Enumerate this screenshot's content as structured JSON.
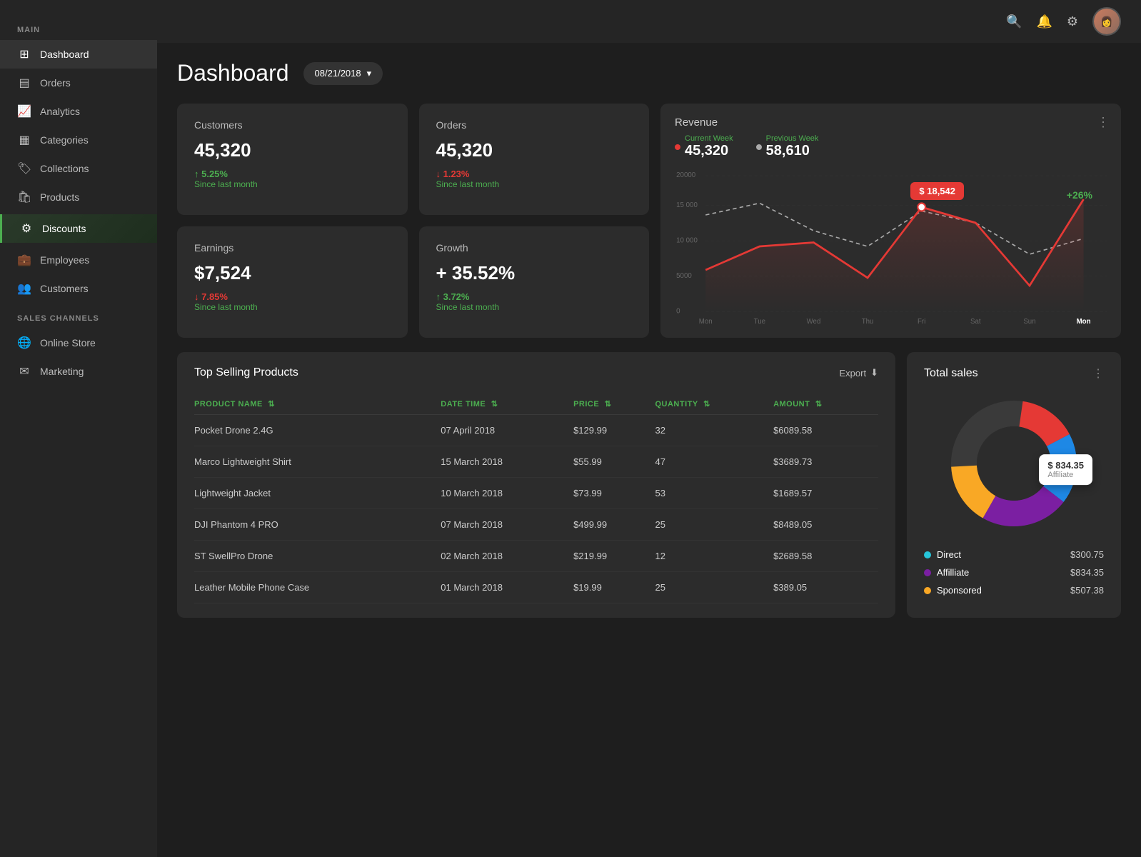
{
  "header": {
    "title": "Dashboard",
    "date": "08/21/2018",
    "icons": {
      "search": "🔍",
      "notification": "🔔",
      "settings": "⚙"
    }
  },
  "sidebar": {
    "main_label": "MAIN",
    "items": [
      {
        "label": "Dashboard",
        "icon": "🏠",
        "active": true
      },
      {
        "label": "Orders",
        "icon": "📦",
        "active": false
      },
      {
        "label": "Analytics",
        "icon": "📈",
        "active": false
      },
      {
        "label": "Categories",
        "icon": "📋",
        "active": false
      },
      {
        "label": "Collections",
        "icon": "🏷",
        "active": false
      },
      {
        "label": "Products",
        "icon": "🛍",
        "active": false
      },
      {
        "label": "Discounts",
        "icon": "🎟",
        "active": false,
        "highlight": true
      },
      {
        "label": "Employees",
        "icon": "👔",
        "active": false
      },
      {
        "label": "Customers",
        "icon": "👥",
        "active": false
      }
    ],
    "sales_label": "SALES CHANNELS",
    "sales_items": [
      {
        "label": "Online Store",
        "icon": "🌐"
      },
      {
        "label": "Marketing",
        "icon": "✉"
      }
    ]
  },
  "stats": {
    "customers": {
      "title": "Customers",
      "value": "45,320",
      "change": "↑ 5.25%",
      "change_type": "up",
      "label": "Since last month"
    },
    "orders": {
      "title": "Orders",
      "value": "45,320",
      "change": "↓ 1.23%",
      "change_type": "down",
      "label": "Since last month"
    },
    "earnings": {
      "title": "Earnings",
      "value": "$7,524",
      "change": "↓ 7.85%",
      "change_type": "down",
      "label": "Since last month"
    },
    "growth": {
      "title": "Growth",
      "value": "+ 35.52%",
      "change": "↑ 3.72%",
      "change_type": "up",
      "label": "Since last month"
    }
  },
  "revenue": {
    "title": "Revenue",
    "current_week_label": "Current Week",
    "previous_week_label": "Previous Week",
    "current_value": "45,320",
    "previous_value": "58,610",
    "tooltip_value": "$ 18,542",
    "percent_change": "+26%",
    "x_labels": [
      "Mon",
      "Tue",
      "Wed",
      "Thu",
      "Fri",
      "Sat",
      "Sun",
      "Mon"
    ],
    "y_labels": [
      "20000",
      "15 000",
      "10 000",
      "5000",
      "0"
    ]
  },
  "top_products": {
    "title": "Top Selling Products",
    "export_label": "Export",
    "columns": [
      {
        "label": "PRODUCT NAME",
        "key": "name"
      },
      {
        "label": "DATE TIME",
        "key": "date"
      },
      {
        "label": "PRICE",
        "key": "price"
      },
      {
        "label": "QUANTITY",
        "key": "qty"
      },
      {
        "label": "AMOUNT",
        "key": "amount"
      }
    ],
    "rows": [
      {
        "name": "Pocket Drone 2.4G",
        "date": "07 April 2018",
        "price": "$129.99",
        "qty": "32",
        "amount": "$6089.58"
      },
      {
        "name": "Marco Lightweight Shirt",
        "date": "15 March 2018",
        "price": "$55.99",
        "qty": "47",
        "amount": "$3689.73"
      },
      {
        "name": "Lightweight Jacket",
        "date": "10 March 2018",
        "price": "$73.99",
        "qty": "53",
        "amount": "$1689.57"
      },
      {
        "name": "DJI Phantom 4 PRO",
        "date": "07 March 2018",
        "price": "$499.99",
        "qty": "25",
        "amount": "$8489.05"
      },
      {
        "name": "ST SwellPro Drone",
        "date": "02 March 2018",
        "price": "$219.99",
        "qty": "12",
        "amount": "$2689.58"
      },
      {
        "name": "Leather Mobile Phone Case",
        "date": "01 March 2018",
        "price": "$19.99",
        "qty": "25",
        "amount": "$389.05"
      }
    ]
  },
  "total_sales": {
    "title": "Total sales",
    "tooltip_value": "$ 834.35",
    "tooltip_label": "Affiliate",
    "legend": [
      {
        "label": "Direct",
        "value": "$300.75",
        "color": "#26c6da"
      },
      {
        "label": "Affilliate",
        "value": "$834.35",
        "color": "#7b1fa2"
      },
      {
        "label": "Sponsored",
        "value": "$507.38",
        "color": "#f9a825"
      }
    ]
  }
}
